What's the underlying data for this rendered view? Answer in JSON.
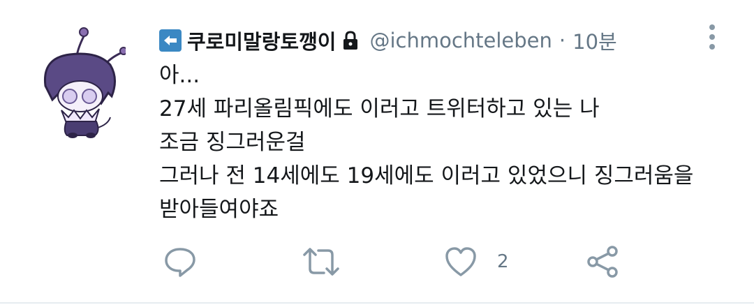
{
  "tweet": {
    "display_name": "쿠로미말랑토깽이",
    "handle": "@ichmochteleben",
    "separator": "·",
    "time": "10분",
    "protected": true,
    "lines": [
      "아...",
      "27세 파리올림픽에도 이러고 트위터하고 있는 나",
      "조금 징그러운걸",
      "그러나 전 14세에도 19세에도 이러고 있었으니 징그러움을",
      "받아들여야죠"
    ]
  },
  "actions": {
    "like_count": "2"
  },
  "colors": {
    "name": "#14171a",
    "secondary": "#657786",
    "icon": "#8899a6",
    "arrow_bg": "#3b88c3"
  }
}
